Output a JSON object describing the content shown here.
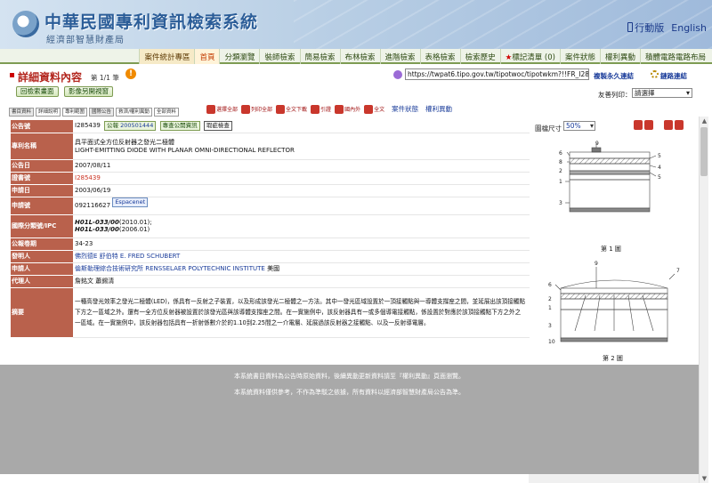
{
  "header": {
    "title": "中華民國專利資訊檢索系統",
    "subtitle": "經濟部智慧財產局",
    "mobile_label": "行動版",
    "english_label": "English"
  },
  "nav": [
    {
      "label": "案件統計專區",
      "style": "stat"
    },
    {
      "label": "首頁",
      "style": "active"
    },
    {
      "label": "分類瀏覽",
      "style": ""
    },
    {
      "label": "裝師檢索",
      "style": ""
    },
    {
      "label": "簡易檢索",
      "style": ""
    },
    {
      "label": "布林檢索",
      "style": ""
    },
    {
      "label": "進階檢索",
      "style": ""
    },
    {
      "label": "表格檢索",
      "style": ""
    },
    {
      "label": "檢索歷史",
      "style": ""
    },
    {
      "label": "標記清單 (0)",
      "style": "star"
    },
    {
      "label": "案件狀態",
      "style": ""
    },
    {
      "label": "權利異動",
      "style": ""
    },
    {
      "label": "積體電路電路布局",
      "style": ""
    }
  ],
  "detail": {
    "title": "詳細資料內容",
    "page_info": "第 1/1 筆",
    "url": "https://twpat6.tipo.gov.tw/tipotwoc/tipotwkm?!!FR_I285439",
    "permalink_label": "複製永久連結",
    "linkcheck_label": "鏈路連結"
  },
  "actions": {
    "back_label": "回檢索畫面",
    "image_label": "影像另開視窗",
    "friendly_label": "友善列印：",
    "friendly_value": "請選擇"
  },
  "tabs": [
    {
      "label": "書目資料",
      "on": true
    },
    {
      "label": "詳細說明",
      "on": false
    },
    {
      "label": "專利範圍",
      "on": false
    },
    {
      "label": "國際公告",
      "on": true
    },
    {
      "label": "救濟/權利異動",
      "on": false
    },
    {
      "label": "全部資料",
      "on": false
    }
  ],
  "tab_icons": [
    "選擇全部",
    "列印全部",
    "全文下載",
    "引證",
    "國內外",
    "全文"
  ],
  "tab_links": {
    "case_status": "案件狀態",
    "rights_change": "權利異動"
  },
  "record": {
    "announce_no_label": "公告號",
    "announce_no": "I285439",
    "announce_btn_label": "公報",
    "announce_btn_no": "200501444",
    "announce_info_label": "專查公開資訊",
    "check_label": "瑕疵檢查",
    "name_label": "專利名稱",
    "name_zh": "具平面式全方位反射器之發光二極體",
    "name_en": "LIGHT-EMITTING DIODE WITH PLANAR OMNI-DIRECTIONAL REFLECTOR",
    "pub_date_label": "公告日",
    "pub_date": "2007/08/11",
    "cert_label": "證書號",
    "cert_no": "I285439",
    "app_date_label": "申請日",
    "app_date": "2003/06/19",
    "app_no_label": "申請號",
    "app_no": "092116627",
    "espacenet_label": "Espacenet",
    "ipc_label": "國際分類號/IPC",
    "ipc_1": "H01L-033/00",
    "ipc_1_date": "(2010.01);",
    "ipc_2": "H01L-033/00",
    "ipc_2_date": "(2006.01)",
    "period_label": "公報卷期",
    "period": "34-23",
    "inventor_label": "發明人",
    "inventor": "佛烈德E 舒伯特 E. FRED SCHUBERT",
    "applicant_label": "申請人",
    "applicant": "倫斯勒理綜合技術研究所 RENSSELAER POLYTECHNIC INSTITUTE",
    "applicant_country": "美國",
    "agent_label": "代理人",
    "agent": "詹銘文 蕭錫清",
    "abstract_label": "摘要",
    "abstract": "一種高發光效率之發光二極體(LED)，係具有一反射之子裝置，以及形成該發光二極體之一方法。其中一發光區域設置於一頂接觸點與一導體支撐座之間，並延展出該頂接觸點下方之一區域之外。還有一全方位反射器被設置於該發光區與該導體支撐座之間。在一實施例中，該反射器具有一或多個導電接觸點，係設置於對應於該頂接觸點下方之外之一區域。在一實施例中，該反射器包括具有一折射係數介於的1.10到2.25間之一介電層、延展過該反射器之接觸點、以及一反射導電層。"
  },
  "image_panel": {
    "size_label": "圖檔尺寸",
    "size_value": "50%",
    "fig1_label": "第 1 圖",
    "fig2_label": "第 2 圖",
    "fig1_nums": [
      "9",
      "6",
      "8",
      "2",
      "1",
      "3",
      "5",
      "4",
      "5"
    ],
    "fig2_nums": [
      "9",
      "7",
      "6",
      "2",
      "1",
      "3",
      "10"
    ]
  },
  "footer": {
    "line1": "本系統書目資料為公告時原始資料，後續異動更新資料請至『權利異動』頁面瀏覽。",
    "line2": "本系統資料僅供參考，不作為準駁之依據，所有資料以經濟部智慧財產局公告為準。"
  }
}
